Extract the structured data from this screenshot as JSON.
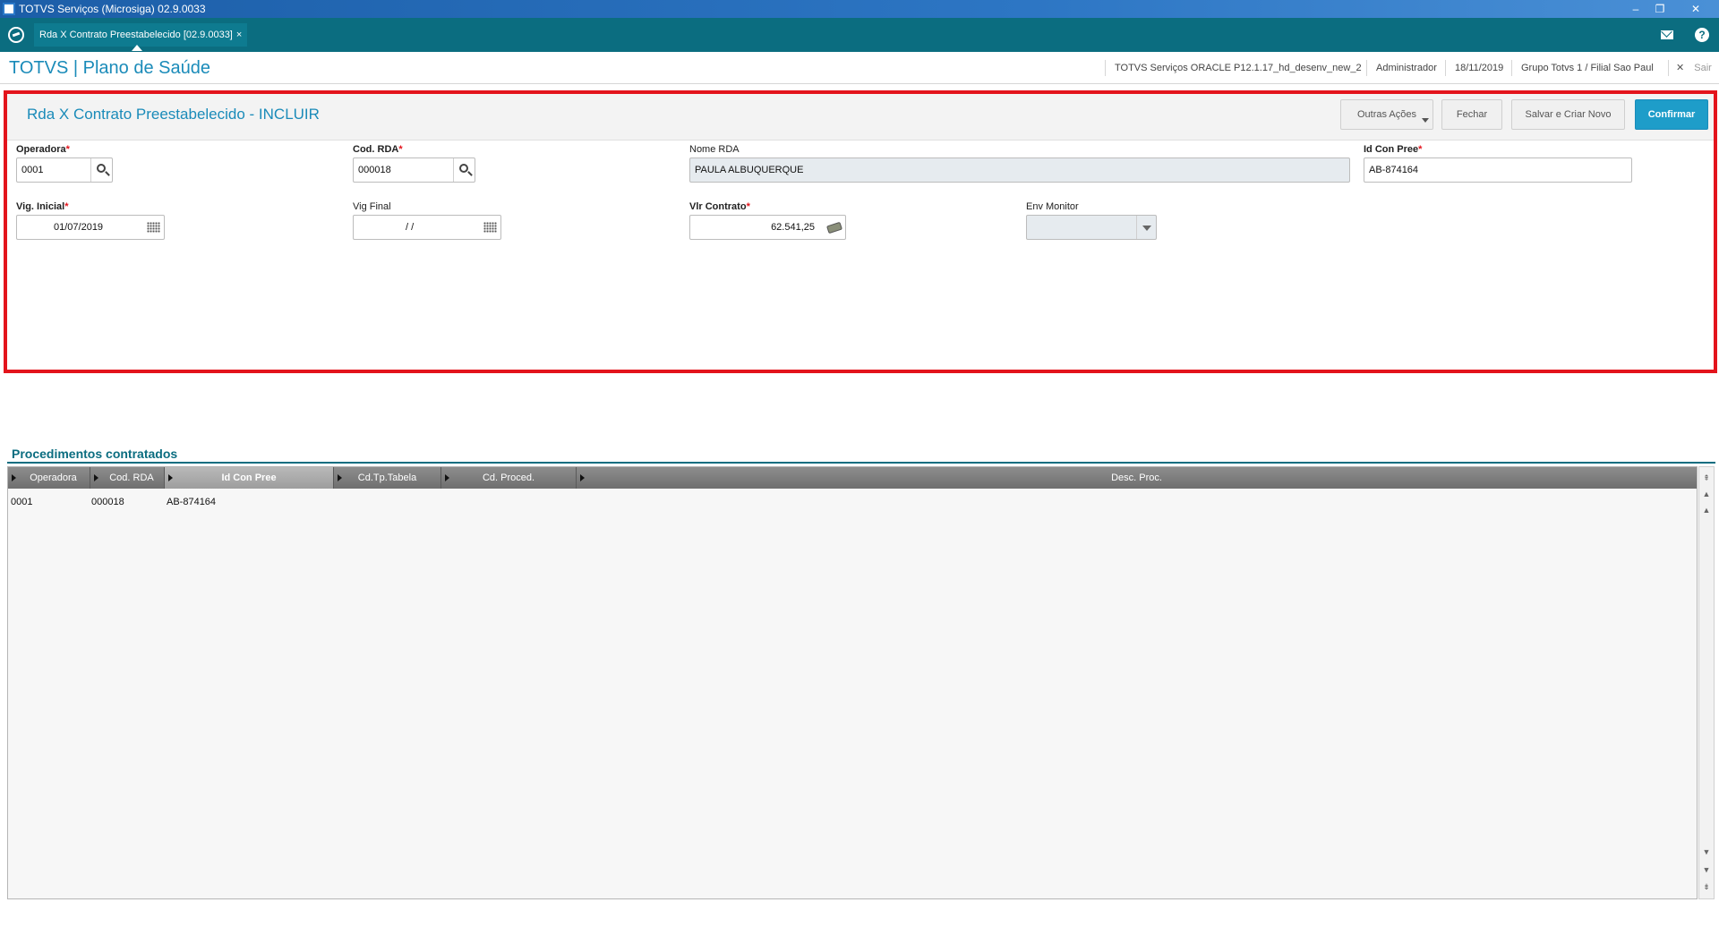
{
  "window": {
    "title": "TOTVS Serviços (Microsiga) 02.9.0033",
    "buttons": {
      "minimize": "–",
      "restore": "❐",
      "close": "✕"
    }
  },
  "tabbar": {
    "active_tab": "Rda X Contrato Preestabelecido [02.9.0033]",
    "tab_close": "×",
    "help_glyph": "?"
  },
  "header": {
    "logo": "TOTVS | Plano de Saúde",
    "environment": "TOTVS Serviços ORACLE P12.1.17_hd_desenv_new_2",
    "user": "Administrador",
    "date": "18/11/2019",
    "branch": "Grupo Totvs 1 / Filial Sao Paul",
    "logout_icon": "✕",
    "logout": "Sair"
  },
  "form": {
    "title": "Rda X Contrato Preestabelecido - INCLUIR",
    "buttons": {
      "other_actions": "Outras Ações",
      "close": "Fechar",
      "save_new": "Salvar e Criar Novo",
      "confirm": "Confirmar"
    },
    "required_mark": "*",
    "fields": {
      "operadora": {
        "label": "Operadora",
        "value": "0001"
      },
      "cod_rda": {
        "label": "Cod. RDA",
        "value": "000018"
      },
      "nome_rda": {
        "label": "Nome RDA",
        "value": "PAULA ALBUQUERQUE"
      },
      "id_con_pree": {
        "label": "Id Con Pree",
        "value": "AB-874164"
      },
      "vig_inicial": {
        "label": "Vig. Inicial",
        "value": "01/07/2019"
      },
      "vig_final": {
        "label": "Vig Final",
        "value": "/ /"
      },
      "vlr_contrato": {
        "label": "Vlr Contrato",
        "value": "62.541,25"
      },
      "env_monitor": {
        "label": "Env Monitor",
        "value": ""
      }
    }
  },
  "grid": {
    "title": "Procedimentos contratados",
    "columns": [
      "Operadora",
      "Cod. RDA",
      "Id Con Pree",
      "Cd.Tp.Tabela",
      "Cd. Proced.",
      "Desc. Proc."
    ],
    "rows": [
      [
        "0001",
        "000018",
        "AB-874164",
        "",
        "",
        ""
      ]
    ],
    "scroll_glyphs": {
      "top": "⇞",
      "up": "▲",
      "down": "▼",
      "bottom": "⇟"
    }
  }
}
